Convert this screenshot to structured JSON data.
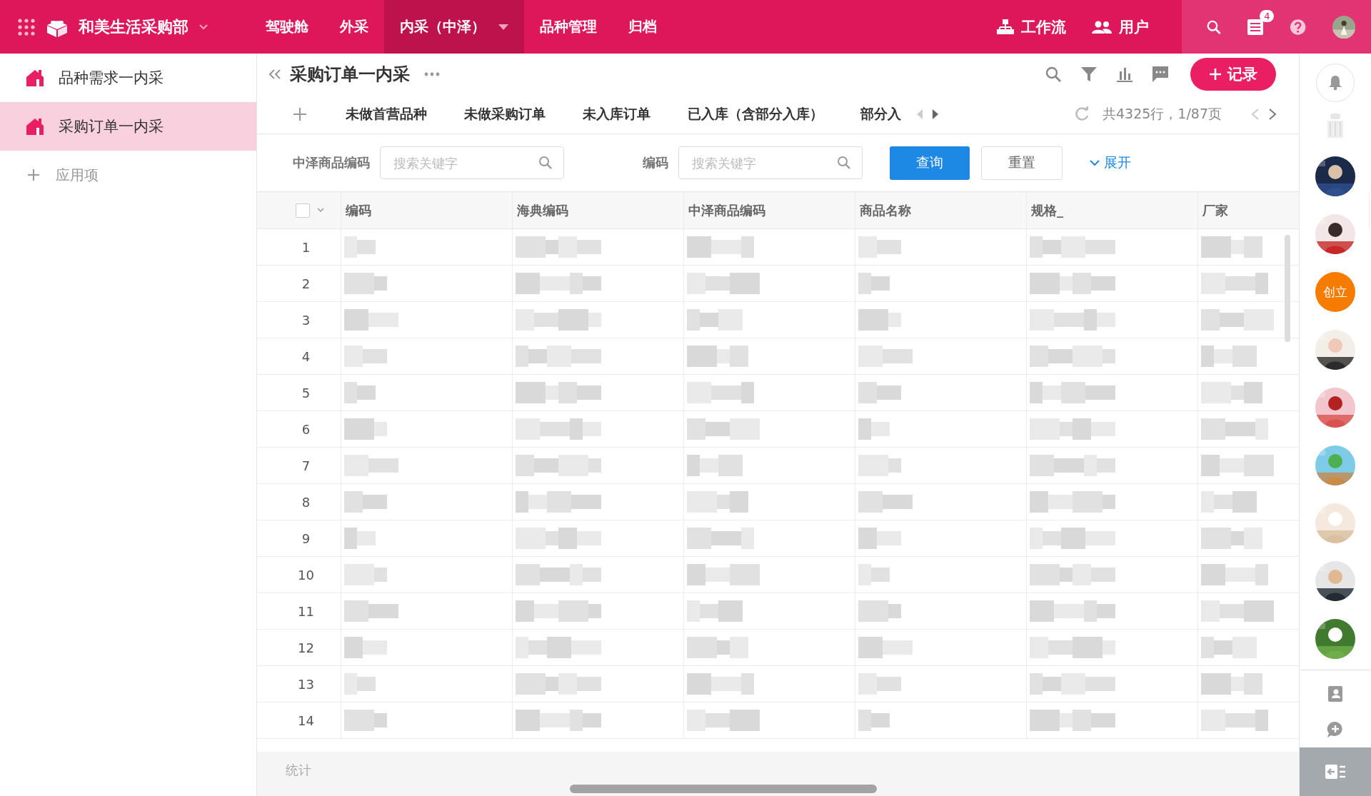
{
  "topbar": {
    "app_name": "和美生活采购部",
    "nav": [
      {
        "label": "驾驶舱",
        "selected": false,
        "dropdown": false
      },
      {
        "label": "外采",
        "selected": false,
        "dropdown": false
      },
      {
        "label": "内采（中泽）",
        "selected": true,
        "dropdown": true
      },
      {
        "label": "品种管理",
        "selected": false,
        "dropdown": false
      },
      {
        "label": "归档",
        "selected": false,
        "dropdown": false
      }
    ],
    "links": [
      {
        "label": "工作流",
        "kind": "workflow"
      },
      {
        "label": "用户",
        "kind": "users"
      }
    ],
    "notification_count": "4"
  },
  "sidebar": {
    "items": [
      {
        "label": "品种需求一内采",
        "selected": false
      },
      {
        "label": "采购订单一内采",
        "selected": true
      }
    ],
    "add_label": "应用项"
  },
  "page": {
    "title": "采购订单一内采",
    "add_button": "记录",
    "tabs": [
      {
        "label": "未做首营品种",
        "selected": false
      },
      {
        "label": "未做采购订单",
        "selected": false
      },
      {
        "label": "未入库订单",
        "selected": false
      },
      {
        "label": "已入库（含部分入库）",
        "selected": false
      },
      {
        "label": "部分入",
        "selected": false
      }
    ],
    "summary": "共4325行，1/87页",
    "filters": [
      {
        "label": "中泽商品编码",
        "placeholder": "搜索关键字"
      },
      {
        "label": "编码",
        "placeholder": "搜索关键字"
      }
    ],
    "query_button": "查询",
    "reset_button": "重置",
    "expand_link": "展开"
  },
  "table": {
    "columns": [
      "编码",
      "海典编码",
      "中泽商品编码",
      "商品名称",
      "规格_",
      "厂家"
    ],
    "select_all": {
      "checked": false
    },
    "rows": [
      {
        "number": "1"
      },
      {
        "number": "2"
      },
      {
        "number": "3"
      },
      {
        "number": "4"
      },
      {
        "number": "5"
      },
      {
        "number": "6"
      },
      {
        "number": "7"
      },
      {
        "number": "8"
      },
      {
        "number": "9"
      },
      {
        "number": "10"
      },
      {
        "number": "11"
      },
      {
        "number": "12"
      },
      {
        "number": "13"
      },
      {
        "number": "14"
      }
    ],
    "footer": "统计"
  },
  "rail": {
    "avatars": [
      {
        "kind": "picture"
      },
      {
        "kind": "picture"
      },
      {
        "kind": "text",
        "label": "创立",
        "color": "#f57c00"
      },
      {
        "kind": "picture"
      },
      {
        "kind": "picture"
      },
      {
        "kind": "picture"
      },
      {
        "kind": "picture"
      },
      {
        "kind": "picture"
      },
      {
        "kind": "picture"
      }
    ]
  }
}
